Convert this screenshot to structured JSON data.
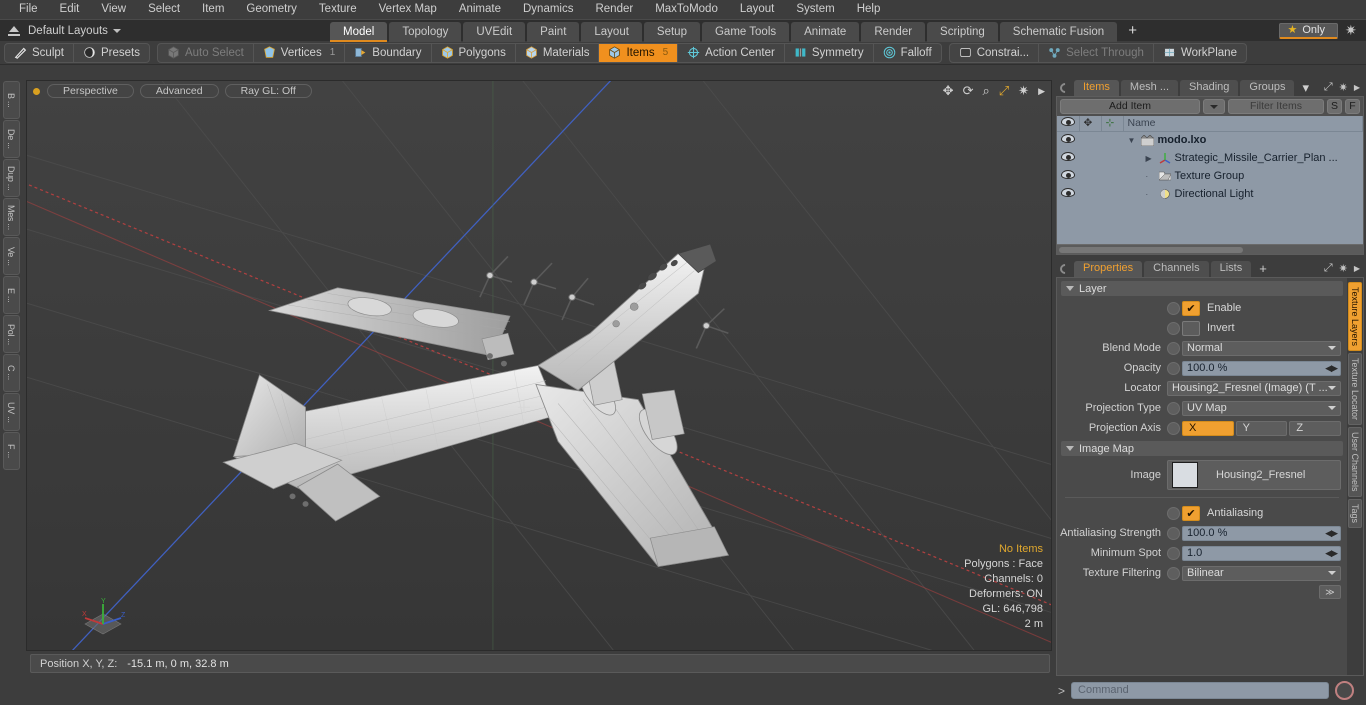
{
  "menu": {
    "items": [
      "File",
      "Edit",
      "View",
      "Select",
      "Item",
      "Geometry",
      "Texture",
      "Vertex Map",
      "Animate",
      "Dynamics",
      "Render",
      "MaxToModo",
      "Layout",
      "System",
      "Help"
    ]
  },
  "layoutbar": {
    "layout_label": "Default Layouts",
    "up_icon": "arrow-up-bar-icon",
    "tabs": [
      {
        "label": "Model",
        "selected": true
      },
      {
        "label": "Topology",
        "selected": false
      },
      {
        "label": "UVEdit",
        "selected": false
      },
      {
        "label": "Paint",
        "selected": false
      },
      {
        "label": "Layout",
        "selected": false
      },
      {
        "label": "Setup",
        "selected": false
      },
      {
        "label": "Game Tools",
        "selected": false
      },
      {
        "label": "Animate",
        "selected": false
      },
      {
        "label": "Render",
        "selected": false
      },
      {
        "label": "Scripting",
        "selected": false
      },
      {
        "label": "Schematic Fusion",
        "selected": false
      }
    ],
    "add_tab_label": "+",
    "only_button": {
      "label": "Only",
      "star": "★"
    },
    "gear_icon": "gear-icon",
    "accent": "#e08a1e"
  },
  "modebar": {
    "group1": [
      {
        "label": "Sculpt",
        "icon": "pen-icon",
        "state": "normal"
      },
      {
        "label": "Presets",
        "icon": "sphere-icon",
        "state": "normal"
      }
    ],
    "group2": [
      {
        "label": "Auto Select",
        "icon": "cube-icon",
        "state": "dim"
      },
      {
        "label": "Vertices",
        "icon": "vertex-icon",
        "state": "normal",
        "count": "1"
      },
      {
        "label": "Boundary",
        "icon": "boundary-icon",
        "state": "normal"
      },
      {
        "label": "Polygons",
        "icon": "polygon-icon",
        "state": "normal"
      },
      {
        "label": "Materials",
        "icon": "material-icon",
        "state": "normal"
      },
      {
        "label": "Items",
        "icon": "items-icon",
        "state": "active",
        "count": "5"
      },
      {
        "label": "Action Center",
        "icon": "crosshair-icon",
        "state": "normal"
      },
      {
        "label": "Symmetry",
        "icon": "symmetry-icon",
        "state": "normal"
      },
      {
        "label": "Falloff",
        "icon": "falloff-icon",
        "state": "normal"
      }
    ],
    "group3": [
      {
        "label": "Constrai...",
        "icon": "constraint-icon",
        "state": "normal"
      },
      {
        "label": "Select Through",
        "icon": "select-through-icon",
        "state": "dim"
      },
      {
        "label": "WorkPlane",
        "icon": "workplane-icon",
        "state": "normal"
      }
    ]
  },
  "left_tool_tabs": [
    "B ...",
    "De ...",
    "Dup ...",
    "Mes ...",
    "Ve ...",
    "E ...",
    "Pol ...",
    "C ...",
    "UV ...",
    "F ..."
  ],
  "viewport": {
    "pills": [
      "Perspective",
      "Advanced",
      "Ray GL: Off"
    ],
    "icons": [
      "move-icon",
      "rotate-icon",
      "zoom-icon",
      "fit-icon",
      "gear-icon",
      "play-icon"
    ],
    "stats": [
      {
        "text": "No Items",
        "highlight": true
      },
      {
        "text": "Polygons : Face",
        "highlight": false
      },
      {
        "text": "Channels: 0",
        "highlight": false
      },
      {
        "text": "Deformers: ON",
        "highlight": false
      },
      {
        "text": "GL: 646,798",
        "highlight": false
      },
      {
        "text": "2 m",
        "highlight": false
      }
    ],
    "gizmo_axes": [
      "X",
      "Y",
      "Z"
    ]
  },
  "position_bar": {
    "label": "Position X, Y, Z:",
    "value": "-15.1 m, 0 m, 32.8 m"
  },
  "items_panel": {
    "tabs": [
      {
        "label": "Items",
        "selected": true
      },
      {
        "label": "Mesh ...",
        "selected": false
      },
      {
        "label": "Shading",
        "selected": false
      },
      {
        "label": "Groups",
        "selected": false
      }
    ],
    "overflow_icon": "chevron-down-icon",
    "expand_icon": "expand-icon",
    "gear_icon": "gear-icon",
    "more_icon": "chevron-right-icon",
    "add_item_label": "Add Item",
    "filter_placeholder": "Filter Items",
    "s_button": "S",
    "f_button": "F",
    "columns": [
      "eye-icon",
      "move-icon",
      "axis-icon",
      "Name"
    ],
    "rows": [
      {
        "name": "modo.lxo",
        "icon": "scene-icon",
        "indent": 0,
        "bold": true,
        "twisty": "▼"
      },
      {
        "name": "Strategic_Missile_Carrier_Plan ...",
        "icon": "axis-icon",
        "indent": 1,
        "bold": false,
        "twisty": "▶"
      },
      {
        "name": "Texture Group",
        "icon": "texture-group-icon",
        "indent": 1,
        "bold": false,
        "twisty": ""
      },
      {
        "name": "Directional Light",
        "icon": "light-icon",
        "indent": 1,
        "bold": false,
        "twisty": ""
      }
    ]
  },
  "properties_panel": {
    "tabs": [
      {
        "label": "Properties",
        "selected": true
      },
      {
        "label": "Channels",
        "selected": false
      },
      {
        "label": "Lists",
        "selected": false
      },
      {
        "label": "+",
        "selected": false
      }
    ],
    "expand_icon": "expand-icon",
    "gear_icon": "gear-icon",
    "more_icon": "chevron-right-icon",
    "sections": [
      {
        "title": "Layer",
        "rows": [
          {
            "type": "checkbox",
            "label": "Enable",
            "checked": true
          },
          {
            "type": "checkbox",
            "label": "Invert",
            "checked": false
          },
          {
            "type": "dropdown",
            "label": "Blend Mode",
            "value": "Normal",
            "dark": true
          },
          {
            "type": "number",
            "label": "Opacity",
            "value": "100.0 %"
          },
          {
            "type": "dropdown",
            "label": "Locator",
            "value": "Housing2_Fresnel (Image) (T ...",
            "dark": true
          },
          {
            "type": "dropdown",
            "label": "Projection Type",
            "value": "UV Map",
            "dark": true
          },
          {
            "type": "segments",
            "label": "Projection Axis",
            "options": [
              "X",
              "Y",
              "Z"
            ],
            "selected": 0
          }
        ]
      },
      {
        "title": "Image Map",
        "rows": [
          {
            "type": "image",
            "label": "Image",
            "value": "Housing2_Fresnel"
          },
          {
            "type": "checkbox",
            "label": "Antialiasing",
            "checked": true
          },
          {
            "type": "number",
            "label": "Antialiasing Strength",
            "value": "100.0 %"
          },
          {
            "type": "number",
            "label": "Minimum Spot",
            "value": "1.0"
          },
          {
            "type": "dropdown",
            "label": "Texture Filtering",
            "value": "Bilinear",
            "dark": true
          }
        ]
      }
    ],
    "footer_button": "≫"
  },
  "right_vertical_tabs": [
    {
      "label": "Texture Layers",
      "selected": true
    },
    {
      "label": "Texture Locator",
      "selected": false
    },
    {
      "label": "User Channels",
      "selected": false
    },
    {
      "label": "Tags",
      "selected": false
    }
  ],
  "command_bar": {
    "prompt": ">",
    "placeholder": "Command",
    "redo_icon": "record-icon"
  },
  "colors": {
    "accent": "#f0a030",
    "panel": "#4a4a4a",
    "field": "#8e99a6"
  }
}
